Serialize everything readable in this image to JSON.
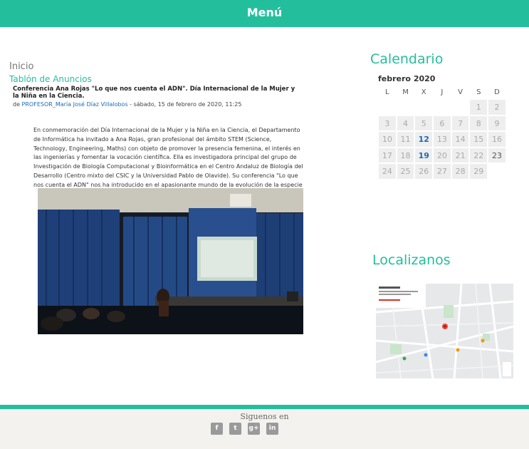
{
  "header": {
    "menu_label": "Menú"
  },
  "breadcrumb": {
    "home": "Inicio"
  },
  "section": {
    "label": "Tablón de Anuncios"
  },
  "post": {
    "title": "Conferencia Ana Rojas \"Lo que nos cuenta el ADN\". Día Internacional de la Mujer y la Niña en la Ciencia.",
    "meta_prefix": "de",
    "author": "PROFESOR_María José Díaz Villalobos",
    "meta_date": "- sábado, 15 de febrero de 2020, 11:25",
    "body": "En conmemoración del Día Internacional de la Mujer y la Niña en la Ciencia, el Departamento de Informática ha invitado a Ana Rojas, gran profesional del ámbito STEM (Science, Technology, Engineering, Maths) con objeto de promover la presencia femenina, el interés en las ingenierías y fomentar la vocación científica. Ella es investigadora principal del grupo de Investigación de Biología Computacional y Bioinformática en el Centro Andaluz de Biología del Desarrollo (Centro mixto del CSIC y la Universidad Pablo de Olavide). Su conferencia \"Lo que nos cuenta el ADN\" nos ha introducido en el apasionante mundo de la evolución de la especie y lo comunicativo."
  },
  "calendar": {
    "title": "Calendario",
    "month": "febrero 2020",
    "weekdays": [
      "L",
      "M",
      "X",
      "J",
      "V",
      "S",
      "D"
    ],
    "weeks": [
      [
        "",
        "",
        "",
        "",
        "",
        "1",
        "2"
      ],
      [
        "3",
        "4",
        "5",
        "6",
        "7",
        "8",
        "9"
      ],
      [
        "10",
        "11",
        "12",
        "13",
        "14",
        "15",
        "16"
      ],
      [
        "17",
        "18",
        "19",
        "20",
        "21",
        "22",
        "23"
      ],
      [
        "24",
        "25",
        "26",
        "27",
        "28",
        "29",
        ""
      ]
    ],
    "event_days": [
      "12",
      "19"
    ],
    "today": "23"
  },
  "location": {
    "title": "Localizanos"
  },
  "footer": {
    "follow_label": "Siguenos en",
    "social": [
      {
        "name": "facebook-icon",
        "glyph": "f"
      },
      {
        "name": "twitter-icon",
        "glyph": "t"
      },
      {
        "name": "google-plus-icon",
        "glyph": "g+"
      },
      {
        "name": "linkedin-icon",
        "glyph": "in"
      }
    ]
  },
  "colors": {
    "accent": "#23bf9d",
    "event": "#1a6bb5",
    "footer_bg": "#f4f2ee"
  }
}
